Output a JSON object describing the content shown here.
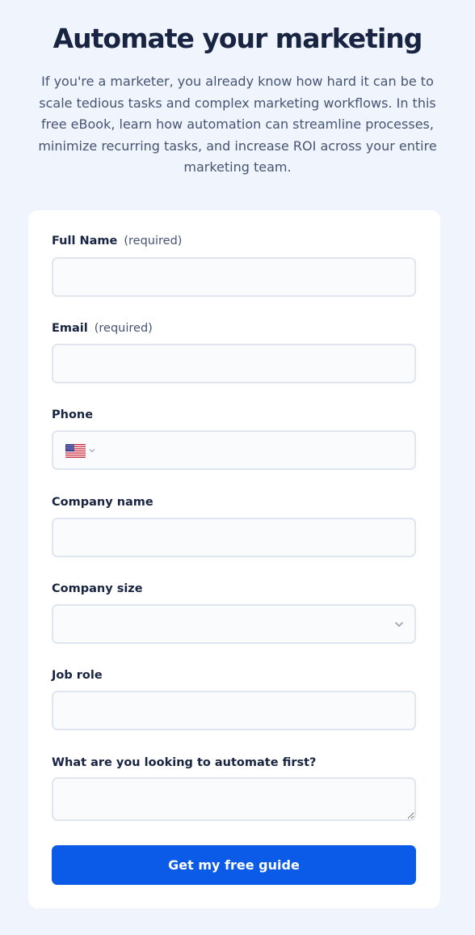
{
  "hero": {
    "title": "Automate your marketing",
    "description": "If you're a marketer, you already know how hard it can be to scale tedious tasks and complex marketing workflows. In this free eBook, learn how automation can streamline processes, minimize recurring tasks, and increase ROI across your entire marketing team."
  },
  "form": {
    "full_name": {
      "label": "Full Name",
      "required_note": "(required)",
      "value": ""
    },
    "email": {
      "label": "Email",
      "required_note": "(required)",
      "value": ""
    },
    "phone": {
      "label": "Phone",
      "country_icon": "us-flag-icon",
      "value": ""
    },
    "company_name": {
      "label": "Company name",
      "value": ""
    },
    "company_size": {
      "label": "Company size",
      "selected": ""
    },
    "job_role": {
      "label": "Job role",
      "value": ""
    },
    "automate_first": {
      "label": "What are you looking to automate first?",
      "value": ""
    },
    "submit_label": "Get my free guide"
  },
  "colors": {
    "page_background": "#f0f5fd",
    "card_background": "#ffffff",
    "accent": "#0b5ae8",
    "heading": "#182442",
    "muted_text": "#465473",
    "input_border": "#e0e6ef"
  }
}
